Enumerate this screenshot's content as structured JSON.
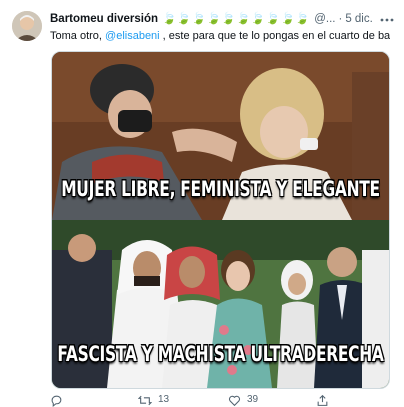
{
  "tweet": {
    "author_name": "Bartomeu diversión",
    "author_emojis": "🍃🍃🍃🍃🍃🍃🍃🍃🍃🍃",
    "handle": "@...",
    "separator": "·",
    "date": "5 dic.",
    "more_icon": "ellipsis-icon",
    "text_before": "Toma otro, ",
    "mention": "@elisabeni",
    "text_after": " , este para que te lo pongas en el cuarto de baño...",
    "meme": {
      "top_caption": "MUJER LIBRE, FEMINISTA Y ELEGANTE",
      "bottom_caption": "FASCISTA Y MACHISTA ULTRADERECHA"
    },
    "actions": {
      "reply_icon": "reply-icon",
      "reply_count": "",
      "retweet_icon": "retweet-icon",
      "retweet_count": "13",
      "like_icon": "heart-icon",
      "like_count": "39",
      "share_icon": "share-icon"
    },
    "colors": {
      "link": "#1d9bf0",
      "secondary_text": "#536471",
      "border": "#cfd9de"
    }
  }
}
